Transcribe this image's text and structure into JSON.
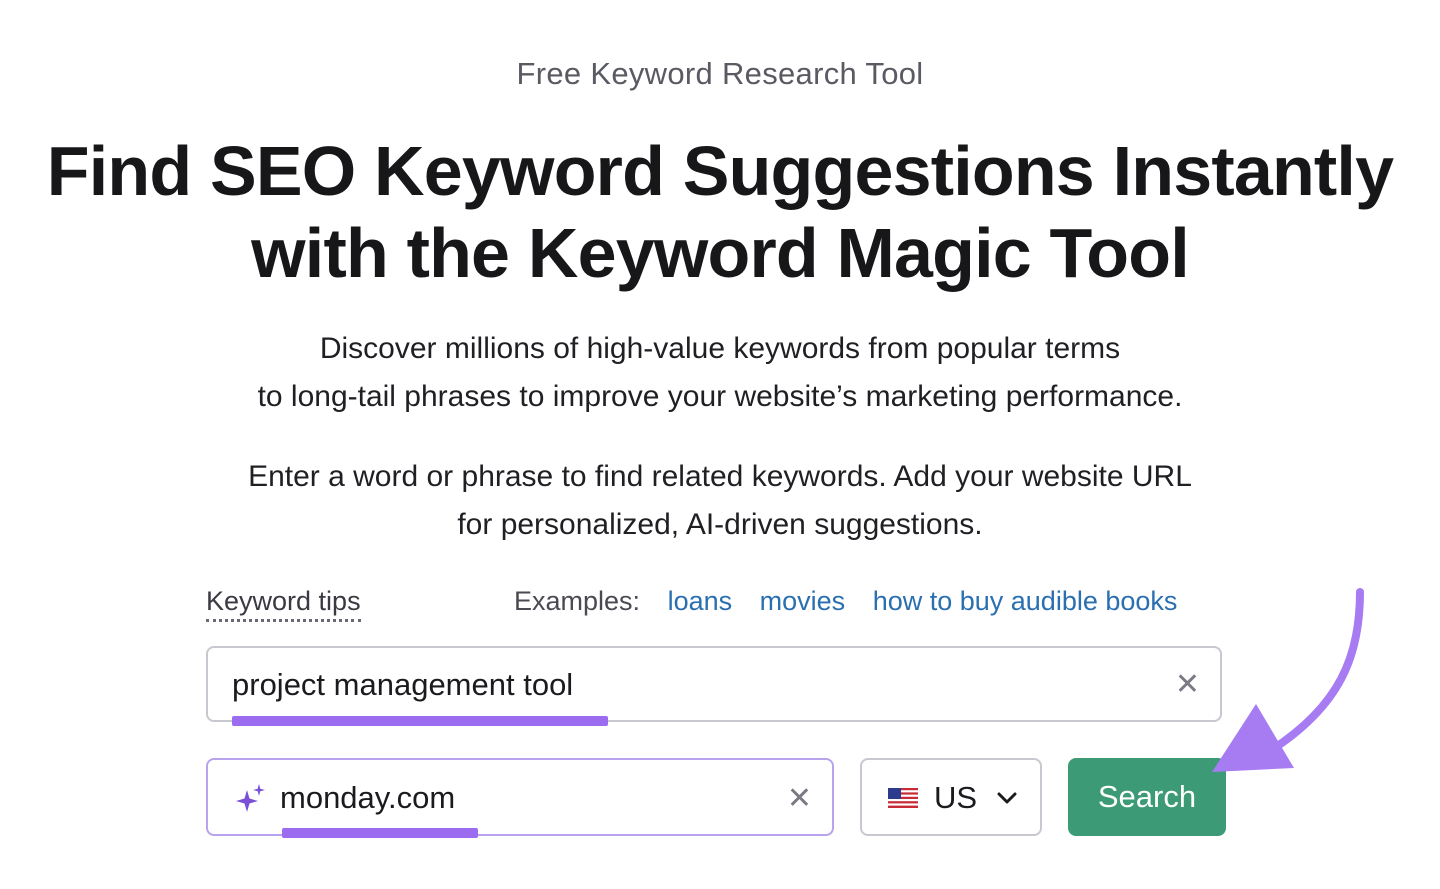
{
  "hero": {
    "eyebrow": "Free Keyword Research Tool",
    "headline_line1": "Find SEO Keyword Suggestions Instantly",
    "headline_line2": "with the Keyword Magic Tool",
    "intro_line1": "Discover millions of high-value keywords from popular terms",
    "intro_line2": "to long-tail phrases to improve your website’s marketing performance.",
    "instruction_line1": "Enter a word or phrase to find related keywords. Add your website URL",
    "instruction_line2": "for personalized, AI-driven suggestions."
  },
  "tips": {
    "label": "Keyword tips",
    "examples_label": "Examples:",
    "examples": [
      "loans",
      "movies",
      "how to buy audible books"
    ]
  },
  "keyword_input": {
    "value": "project management tool",
    "clear_glyph": "✕"
  },
  "url_input": {
    "value": "monday.com",
    "clear_glyph": "✕",
    "icon": "sparkle-icon"
  },
  "country": {
    "code": "US",
    "flag": "us-flag-icon"
  },
  "search_button": {
    "label": "Search"
  },
  "colors": {
    "accent_green": "#3d9a76",
    "highlight_purple": "#9b6cf0",
    "link_blue": "#2a6fb0"
  }
}
